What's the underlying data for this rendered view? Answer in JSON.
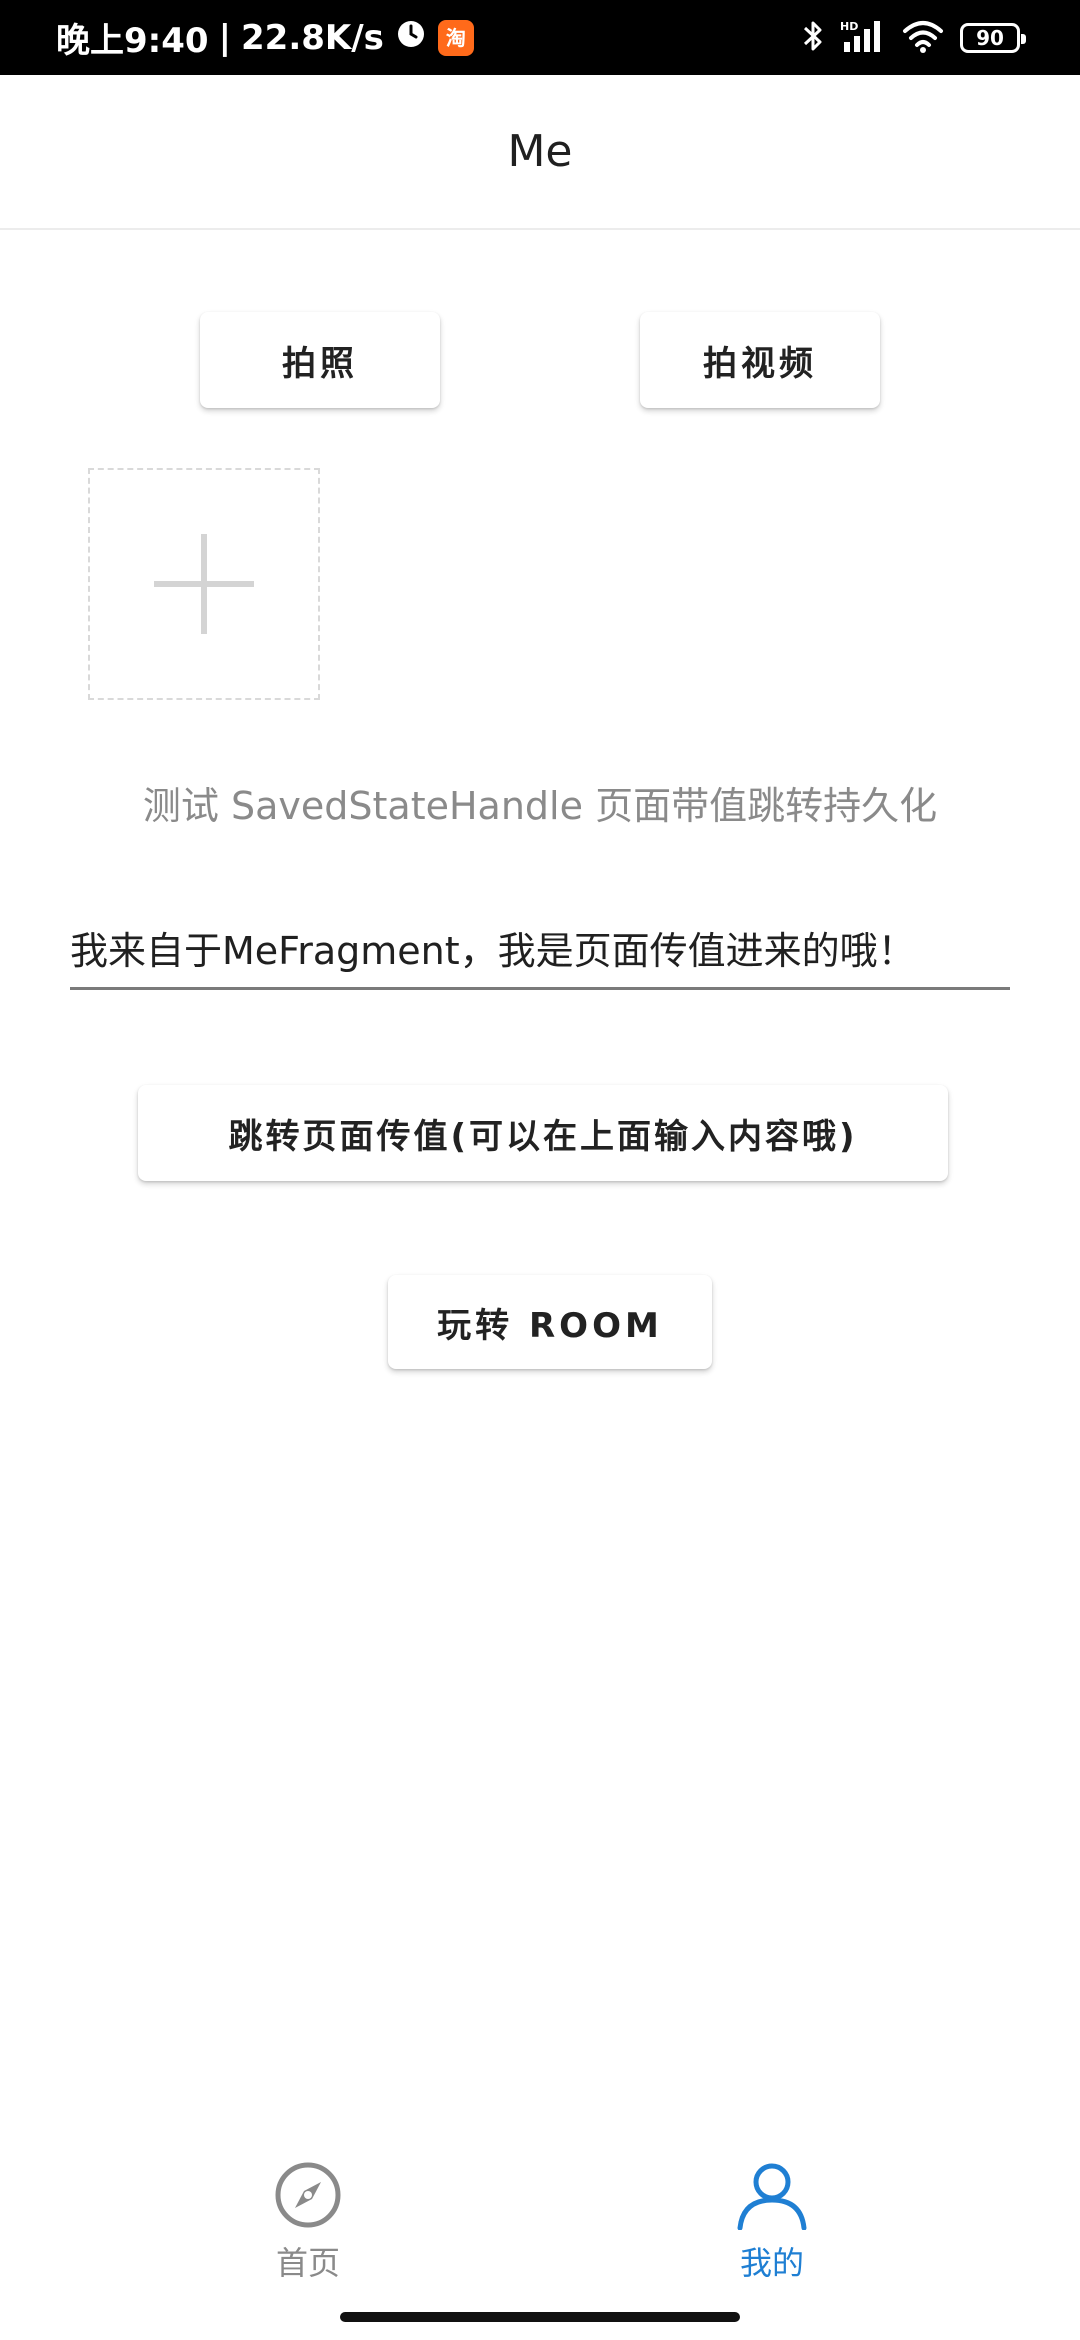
{
  "status_bar": {
    "time": "晚上9:40",
    "net_speed": "22.8K/s",
    "separator": "|",
    "taobao_label": "淘",
    "battery": "90"
  },
  "toolbar": {
    "title": "Me"
  },
  "actions": {
    "take_photo_label": "拍照",
    "take_video_label": "拍视频"
  },
  "hint": {
    "text": "测试 SavedStateHandle 页面带值跳转持久化"
  },
  "message_input": {
    "value": "我来自于MeFragment，我是页面传值进来的哦！"
  },
  "navigate_button": {
    "label": "跳转页面传值(可以在上面输入内容哦)"
  },
  "room_button": {
    "label": "玩转 ROOM"
  },
  "bottom_nav": {
    "items": [
      {
        "label": "首页",
        "icon": "compass-icon",
        "active": false
      },
      {
        "label": "我的",
        "icon": "person-icon",
        "active": true
      }
    ]
  },
  "colors": {
    "accent": "#1f7fd3",
    "inactive": "#8a8a8a"
  }
}
